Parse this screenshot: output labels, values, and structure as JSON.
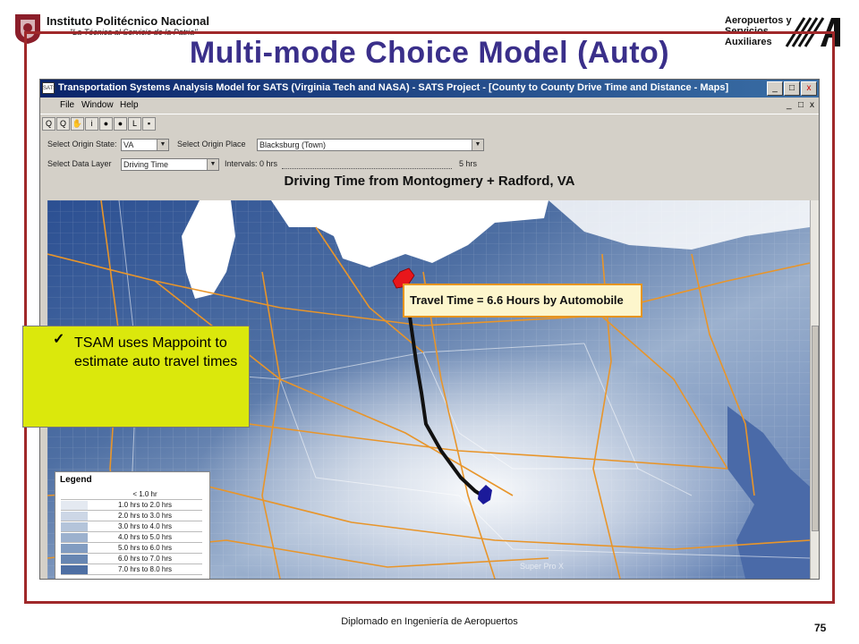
{
  "header": {
    "institution_name": "Instituto Politécnico Nacional",
    "institution_motto": "\"La Técnica al Servicio de la Patria\"",
    "partner_lines": [
      "Aeropuertos y",
      "Servicios",
      "Auxiliares"
    ]
  },
  "slide": {
    "title": "Multi-mode Choice Model (Auto)",
    "footer": "Diplomado en Ingeniería de Aeropuertos",
    "page_number": "75",
    "note_text": "TSAM uses Mappoint to estimate auto travel times",
    "note_check": "✓"
  },
  "app": {
    "icon_text": "SATS",
    "window_title": "Transportation Systems Analysis Model for SATS (Virginia Tech and NASA) - SATS Project - [County to County Drive Time and Distance - Maps]",
    "window_buttons": [
      "_",
      "□",
      "x"
    ],
    "menu": [
      "File",
      "Window",
      "Help"
    ],
    "mdi_buttons": [
      "_",
      "□",
      "x"
    ],
    "toolbar_icons": [
      "Q",
      "Q",
      "✋",
      "i",
      "●",
      "●",
      "L",
      "▪"
    ],
    "origin_state_label": "Select Origin State:",
    "origin_state_value": "VA",
    "origin_place_label": "Select Origin Place",
    "origin_place_value": "Blacksburg (Town)",
    "data_layer_label": "Select Data Layer",
    "data_layer_value": "Driving Time",
    "intervals_label": "Intervals: 0 hrs",
    "intervals_max": "5 hrs",
    "map_title": "Driving Time from Montogmery + Radford, VA"
  },
  "map": {
    "callout": "Travel Time = 6.6 Hours by Automobile",
    "watermark": "Super Pro X",
    "legend_title": "Legend",
    "legend_items": [
      {
        "label": "< 1.0 hr",
        "color": "#ffffff"
      },
      {
        "label": "1.0 hrs to 2.0 hrs",
        "color": "#e4e9f1"
      },
      {
        "label": "2.0 hrs to 3.0 hrs",
        "color": "#cdd7e6"
      },
      {
        "label": "3.0 hrs to 4.0 hrs",
        "color": "#b4c4da"
      },
      {
        "label": "4.0 hrs to 5.0 hrs",
        "color": "#9cb1ce"
      },
      {
        "label": "5.0 hrs to 6.0 hrs",
        "color": "#819cc1"
      },
      {
        "label": "6.0 hrs to 7.0 hrs",
        "color": "#6786b2"
      },
      {
        "label": "7.0 hrs to 8.0 hrs",
        "color": "#4e6fa3"
      }
    ],
    "colors": {
      "lake": "#ffffff",
      "roads": "#e8952a",
      "route": "#111111",
      "origin": "#1b1a9a",
      "destination": "#e8161b"
    }
  },
  "colors": {
    "title": "#3a2f8a",
    "frame": "#a0282a",
    "note_bg": "#dbe80c",
    "callout_border": "#e69520"
  }
}
